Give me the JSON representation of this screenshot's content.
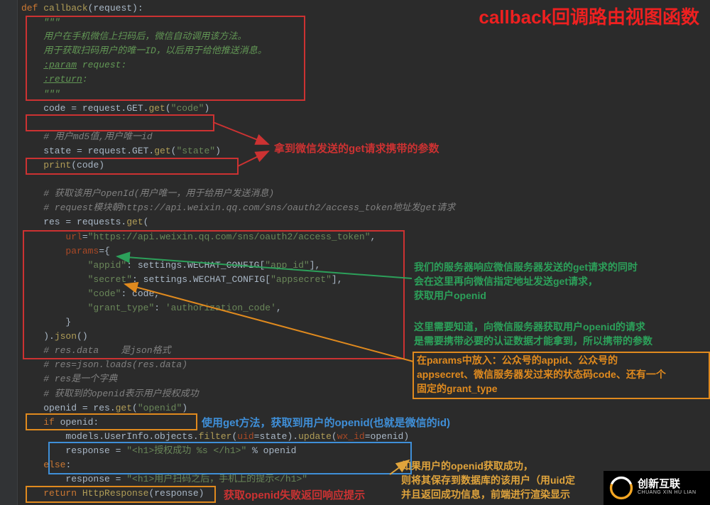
{
  "title_anno": "callback回调路由视图函数",
  "code": {
    "l01a": "def ",
    "l01b": "callback",
    "l01c": "(request):",
    "l02": "    \"\"\"",
    "l03": "    用户在手机微信上扫码后，微信自动调用该方法。",
    "l04": "    用于获取扫码用户的唯一ID，以后用于给他推送消息。",
    "l05a": "    ",
    "l05b": ":param",
    "l05c": " request:",
    "l06a": "    ",
    "l06b": ":return",
    "l06c": ":",
    "l07": "    \"\"\"",
    "l08a": "    code = request.GET.",
    "l08b": "get",
    "l08c": "(",
    "l08d": "\"code\"",
    "l08e": ")",
    "l10": "    # 用户md5值,用户唯一id",
    "l11a": "    state = request.GET.",
    "l11b": "get",
    "l11c": "(",
    "l11d": "\"state\"",
    "l11e": ")",
    "l12a": "    ",
    "l12b": "print",
    "l12c": "(code)",
    "l14": "    # 获取该用户openId(用户唯一，用于给用户发送消息)",
    "l15": "    # request模块朝https://api.weixin.qq.com/sns/oauth2/access_token地址发get请求",
    "l16a": "    res = requests.",
    "l16b": "get",
    "l16c": "(",
    "l17a": "        ",
    "l17b": "url",
    "l17c": "=",
    "l17d": "\"https://api.weixin.qq.com/sns/oauth2/access_token\"",
    "l17e": ",",
    "l18a": "        ",
    "l18b": "params",
    "l18c": "={",
    "l19a": "            ",
    "l19b": "\"appid\"",
    "l19c": ": settings.WECHAT_CONFIG[",
    "l19d": "\"app_id\"",
    "l19e": "],",
    "l20a": "            ",
    "l20b": "\"secret\"",
    "l20c": ": settings.WECHAT_CONFIG[",
    "l20d": "\"appsecret\"",
    "l20e": "],",
    "l21a": "            ",
    "l21b": "\"code\"",
    "l21c": ": code,",
    "l22a": "            ",
    "l22b": "\"grant_type\"",
    "l22c": ": ",
    "l22d": "'authorization_code'",
    "l22e": ",",
    "l23": "        }",
    "l24a": "    ).",
    "l24b": "json",
    "l24c": "()",
    "l25": "    # res.data    是json格式",
    "l26": "    # res=json.loads(res.data)",
    "l27": "    # res是一个字典",
    "l28": "    # 获取到的openid表示用户授权成功",
    "l29a": "    openid = res.",
    "l29b": "get",
    "l29c": "(",
    "l29d": "\"openid\"",
    "l29e": ")",
    "l30a": "    ",
    "l30b": "if ",
    "l30c": "openid:",
    "l31a": "        models.UserInfo.objects.",
    "l31b": "filter",
    "l31c": "(",
    "l31d": "uid",
    "l31e": "=state).",
    "l31f": "update",
    "l31g": "(",
    "l31h": "wx_id",
    "l31i": "=openid)",
    "l32a": "        response = ",
    "l32b": "\"<h1>授权成功 %s </h1>\" ",
    "l32c": "% openid",
    "l33a": "    ",
    "l33b": "else",
    "l33c": ":",
    "l34a": "        response = ",
    "l34b": "\"<h1>用户扫码之后，手机上的提示</h1>\"",
    "l35a": "    ",
    "l35b": "return ",
    "l35c": "HttpResponse",
    "l35d": "(response)"
  },
  "anno": {
    "a1": "拿到微信发送的get请求携带的参数",
    "a2_l1": "我们的服务器响应微信服务器发送的get请求的同时",
    "a2_l2": "会在这里再向微信指定地址发送get请求，",
    "a2_l3": "获取用户openid",
    "a3_l1": "这里需要知道，向微信服务器获取用户openid的请求",
    "a3_l2": "是需要携带必要的认证数据才能拿到，所以携带的参数",
    "a4_l1": "在params中放入：公众号的appid、公众号的",
    "a4_l2": "appsecret、微信服务器发过来的状态码code、还有一个",
    "a4_l3": "固定的grant_type",
    "a5": "使用get方法，获取到用户的openid(也就是微信的id)",
    "a6": "获取openid失败返回响应提示",
    "a7_l1": "如果用户的openid获取成功，",
    "a7_l2": "则将其保存到数据库的该用户（用uid定",
    "a7_l3": "并且返回成功信息，前端进行渲染显示"
  },
  "logo": {
    "name": "创新互联",
    "sub": "CHUANG XIN HU LIAN"
  }
}
